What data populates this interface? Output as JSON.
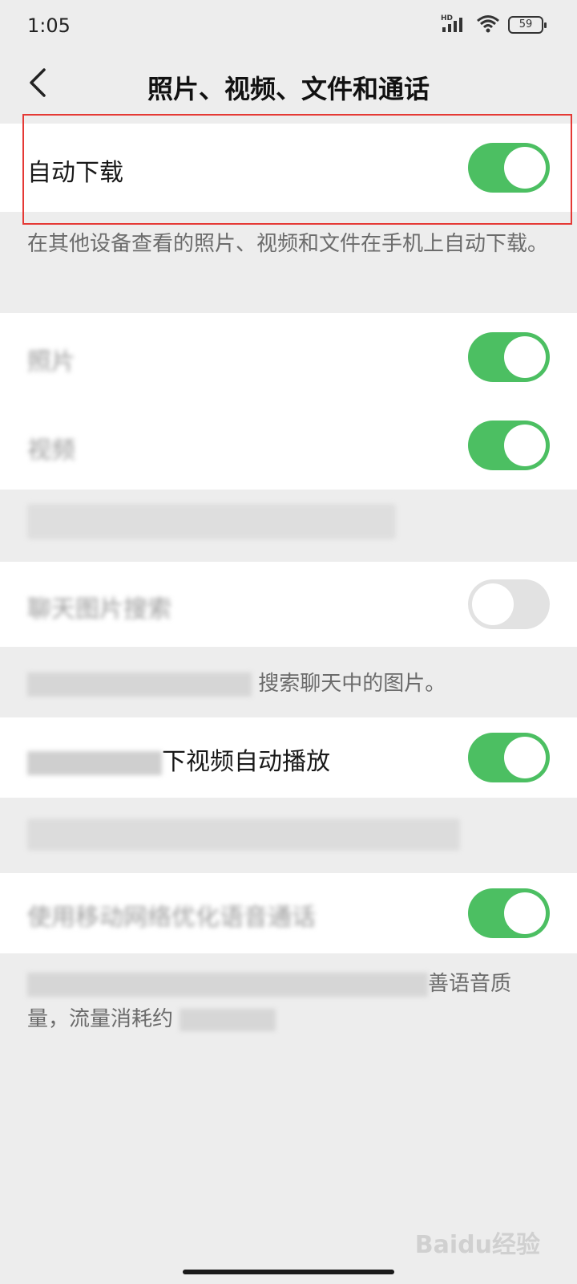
{
  "status_bar": {
    "time": "1:05",
    "network_label": "HD",
    "battery_level": "59"
  },
  "nav": {
    "title": "照片、视频、文件和通话"
  },
  "auto_download": {
    "label": "自动下载",
    "enabled": true,
    "note": "在其他设备查看的照片、视频和文件在手机上自动下载。"
  },
  "visible_text_fragments": {
    "photo_search_note_tail": "搜索聊天中的图片。",
    "video_autoplay_label_tail": "下视频自动播放",
    "voice_note_tail_line1": "善语音质",
    "voice_note_tail_line2": "量，流量消耗约"
  },
  "settings": [
    {
      "label_blurred": "照片",
      "enabled": true
    },
    {
      "label_blurred": "视频",
      "enabled": true
    },
    {
      "label_blurred": "聊天图片搜索",
      "enabled": false
    },
    {
      "label_blurred": "移动网络下视频自动播放",
      "enabled": true
    },
    {
      "label_blurred": "使用移动网络优化语音通话",
      "enabled": true
    }
  ],
  "watermark": "Baidu经验",
  "colors": {
    "toggle_on": "#4cbf62",
    "toggle_off": "#e2e2e2",
    "highlight": "#e53935",
    "background": "#ededed"
  }
}
